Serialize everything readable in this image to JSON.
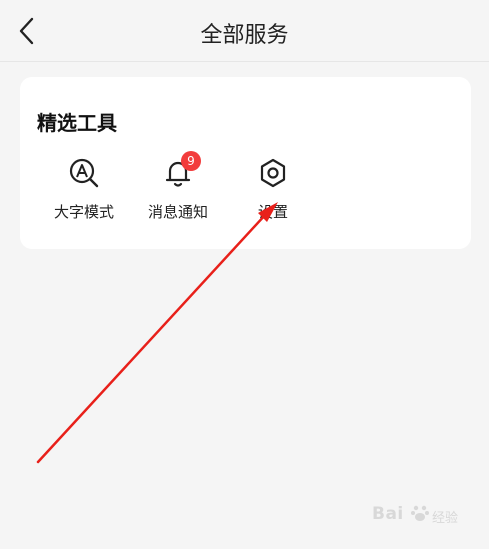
{
  "header": {
    "back_icon": "chevron-left-icon",
    "title": "全部服务"
  },
  "section": {
    "title": "精选工具",
    "tools": [
      {
        "label": "大字模式",
        "icon": "magnifier-a-icon"
      },
      {
        "label": "消息通知",
        "icon": "bell-icon",
        "badge": "9"
      },
      {
        "label": "设置",
        "icon": "hexagon-gear-icon"
      }
    ]
  },
  "colors": {
    "background": "#f5f5f5",
    "card": "#ffffff",
    "badge": "#f23c3c",
    "annotation_arrow": "#e8201a"
  },
  "watermark": {
    "brand": "Bai",
    "text": "经验"
  }
}
